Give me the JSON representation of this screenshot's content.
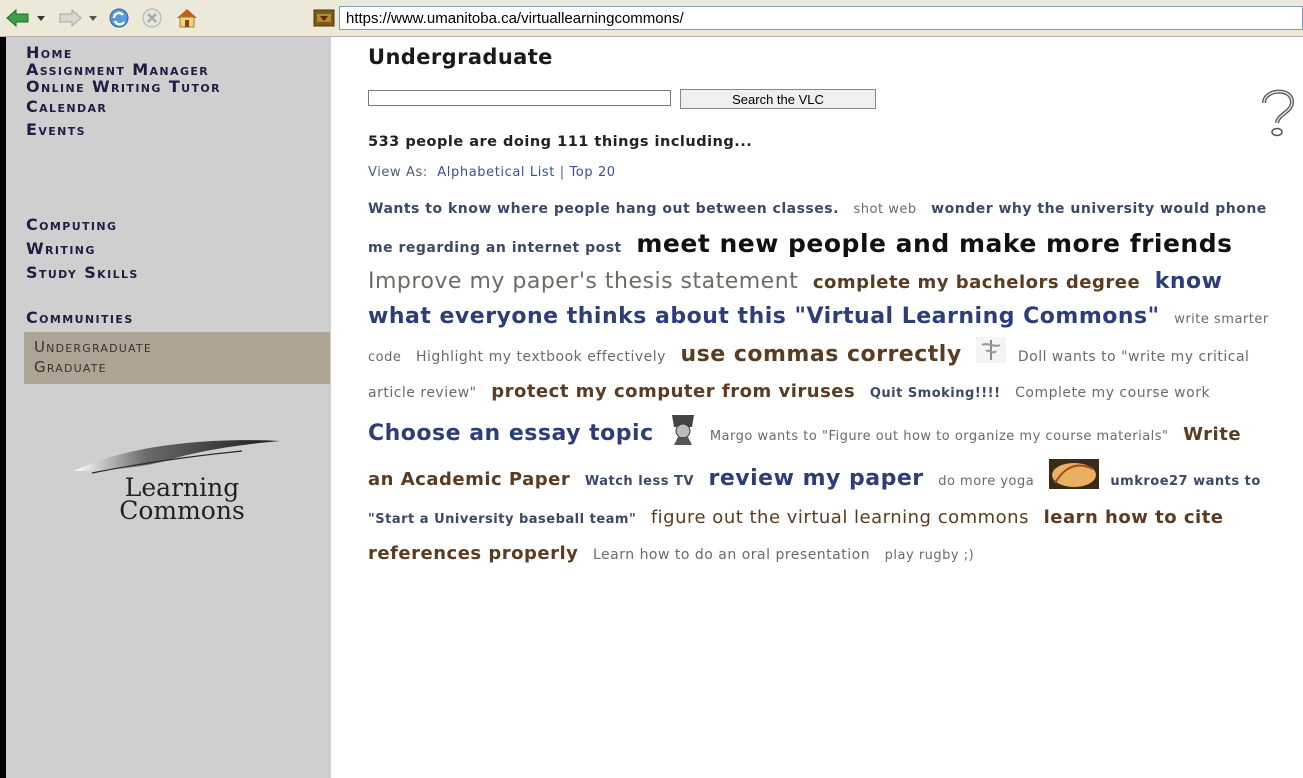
{
  "browser": {
    "url": "https://www.umanitoba.ca/virtuallearningcommons/"
  },
  "sidebar": {
    "primary": [
      {
        "label": "Home"
      },
      {
        "label": "Assignment Manager"
      },
      {
        "label": "Online Writing Tutor"
      },
      {
        "label": "Calendar"
      },
      {
        "label": "Events"
      }
    ],
    "secondary": [
      {
        "label": "Computing"
      },
      {
        "label": "Writing"
      },
      {
        "label": "Study Skills"
      }
    ],
    "communities_heading": "Communities",
    "communities": [
      {
        "label": "Undergraduate"
      },
      {
        "label": "Graduate"
      }
    ],
    "logo": {
      "line1": "Learning",
      "line2": "Commons"
    }
  },
  "main": {
    "title": "Undergraduate",
    "search": {
      "value": "",
      "button_label": "Search the VLC"
    },
    "stat_line": "533 people are doing 111 things including...",
    "view_as_label": "View As:",
    "view_options": [
      "Alphabetical List",
      "Top 20"
    ],
    "view_separator": "|",
    "tags": [
      "Wants to know where people hang out between classes.",
      "shot web",
      "wonder why the university would phone me regarding an internet post",
      "meet new people and make more friends",
      "Improve my paper's thesis statement",
      "complete my bachelors degree",
      "know what everyone thinks about this \"Virtual Learning Commons\"",
      "write smarter code",
      "Highlight my textbook effectively",
      "use commas correctly",
      "Doll wants to \"write my critical article review\"",
      "protect my computer from viruses",
      "Quit Smoking!!!!",
      "Complete my course work",
      "Choose an essay topic",
      "Margo wants to \"Figure out how to organize my course materials\"",
      "Write an Academic Paper",
      "Watch less TV",
      "review my paper",
      "do more yoga",
      "umkroe27 wants to \"Start a University baseball team\"",
      "figure out the virtual learning commons",
      "learn how to cite references properly",
      "Learn how to do an oral presentation",
      "play rugby ;)"
    ]
  },
  "colors": {
    "sidebar_bg": "#cfcfcf",
    "communities_bg": "#afa394",
    "nav_text": "#1e1d45",
    "tag_brown": "#5a3c22",
    "tag_blue": "#2c3e7a",
    "tag_grey": "#6e6a64"
  }
}
